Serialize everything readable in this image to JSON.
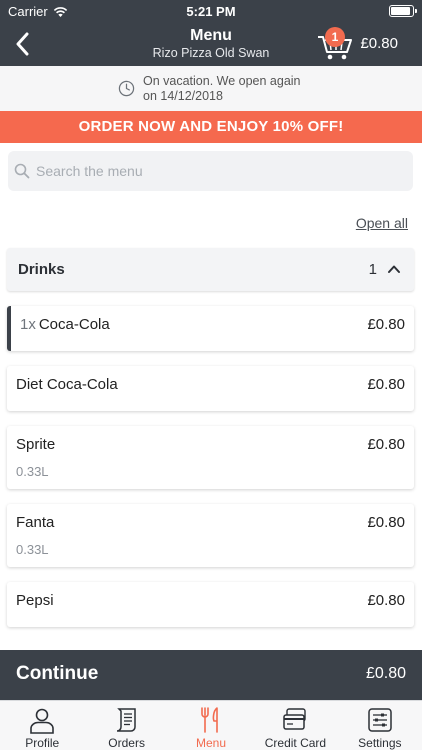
{
  "status_bar": {
    "carrier": "Carrier",
    "time": "5:21 PM"
  },
  "header": {
    "title": "Menu",
    "subtitle": "Rizo Pizza Old Swan",
    "cart_count": "1",
    "cart_total": "£0.80"
  },
  "notice": {
    "line1": "On vacation. We open again",
    "line2": "on 14/12/2018"
  },
  "promo": {
    "text": "ORDER NOW AND ENJOY 10% OFF!"
  },
  "search": {
    "placeholder": "Search the menu",
    "value": ""
  },
  "open_all": "Open all",
  "category": {
    "name": "Drinks",
    "count": "1"
  },
  "items": [
    {
      "qty": "1x",
      "name": "Coca-Cola",
      "price": "£0.80",
      "desc": ""
    },
    {
      "qty": "",
      "name": "Diet Coca-Cola",
      "price": "£0.80",
      "desc": ""
    },
    {
      "qty": "",
      "name": "Sprite",
      "price": "£0.80",
      "desc": "0.33L"
    },
    {
      "qty": "",
      "name": "Fanta",
      "price": "£0.80",
      "desc": "0.33L"
    },
    {
      "qty": "",
      "name": "Pepsi",
      "price": "£0.80",
      "desc": ""
    }
  ],
  "continue": {
    "label": "Continue",
    "total": "£0.80"
  },
  "tabs": [
    {
      "label": "Profile",
      "icon": "profile-icon"
    },
    {
      "label": "Orders",
      "icon": "orders-icon"
    },
    {
      "label": "Menu",
      "icon": "menu-icon"
    },
    {
      "label": "Credit Card",
      "icon": "credit-card-icon"
    },
    {
      "label": "Settings",
      "icon": "settings-icon"
    }
  ],
  "colors": {
    "dark": "#3b4149",
    "accent": "#f26b4f",
    "promo": "#f5694e"
  }
}
